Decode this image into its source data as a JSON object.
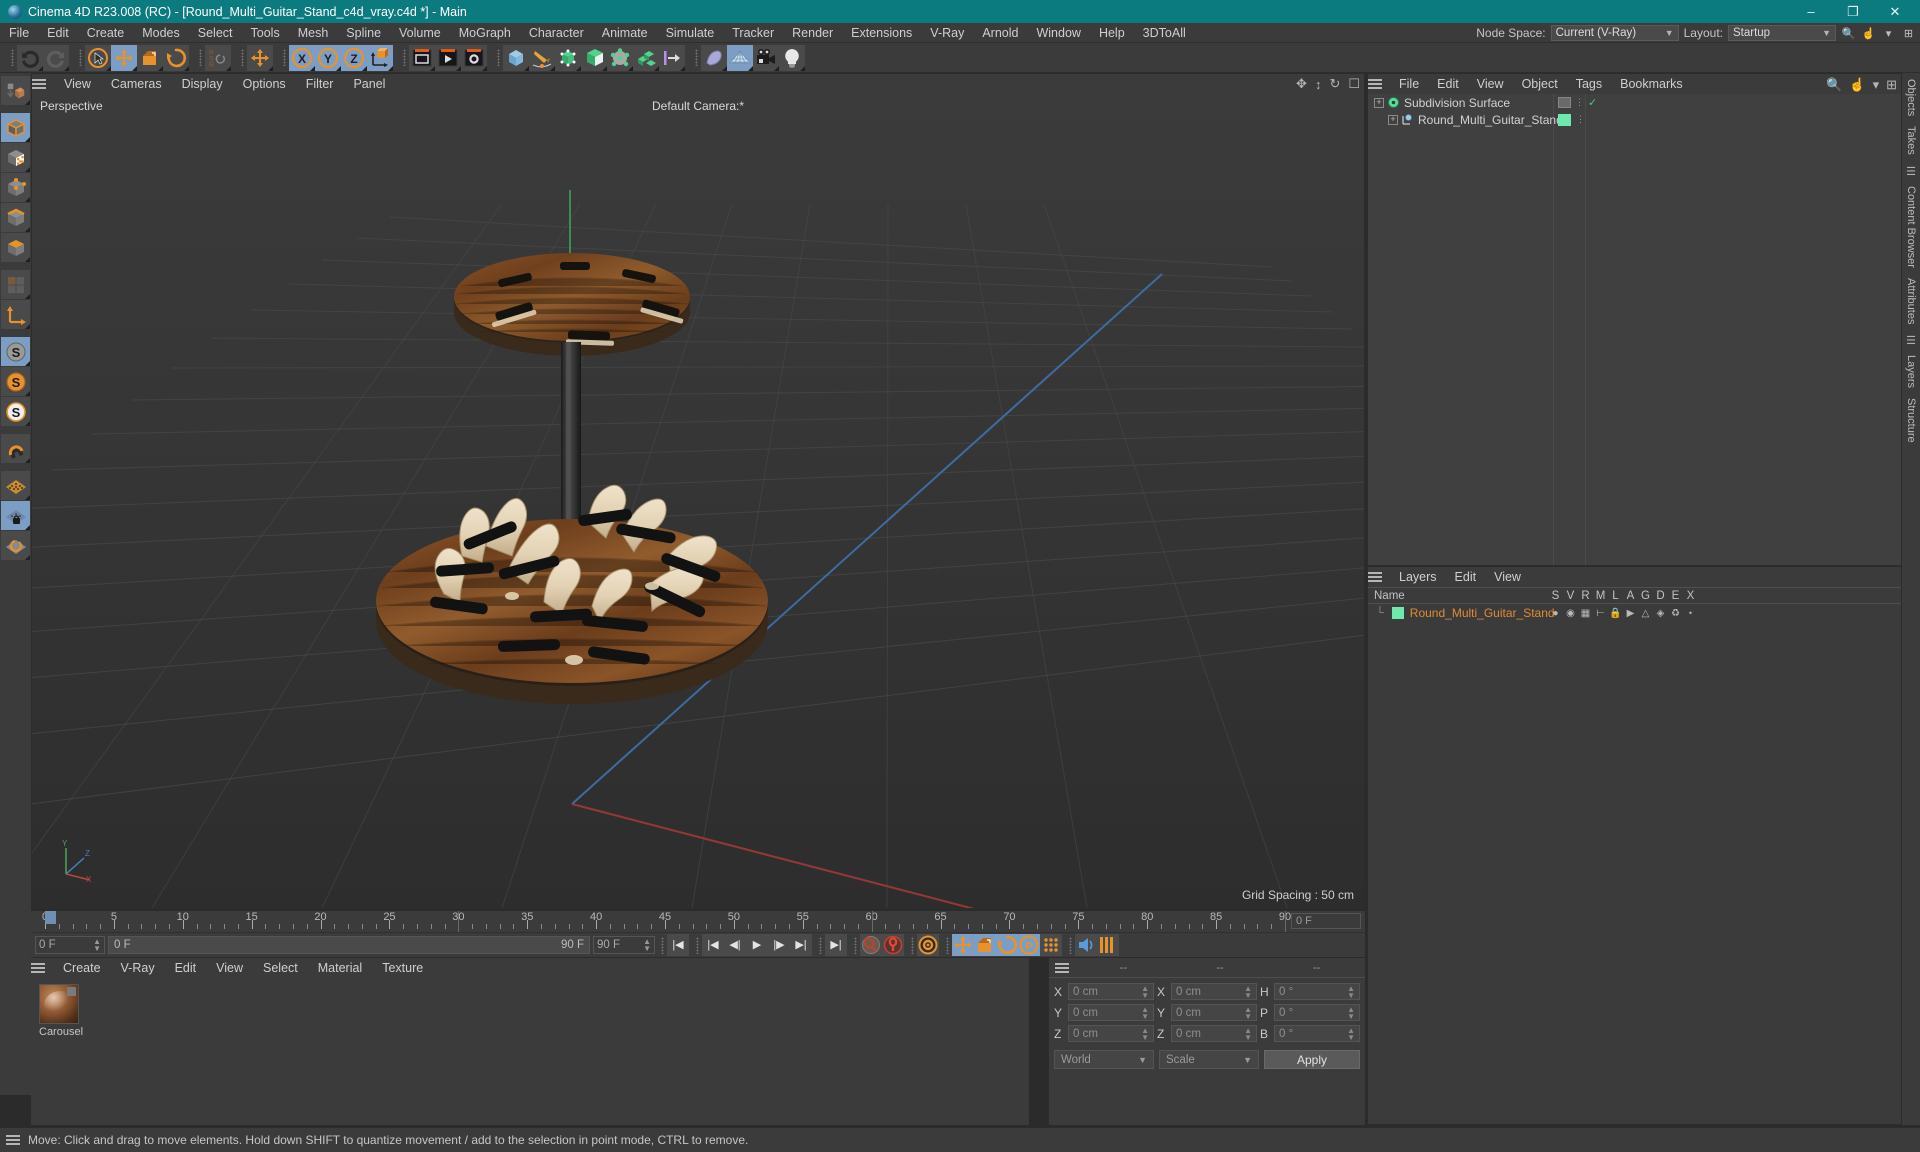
{
  "window": {
    "title": "Cinema 4D R23.008 (RC) - [Round_Multi_Guitar_Stand_c4d_vray.c4d *] - Main",
    "minimize": "–",
    "maximize": "❐",
    "close": "✕"
  },
  "menubar": {
    "items": [
      "File",
      "Edit",
      "Create",
      "Modes",
      "Select",
      "Tools",
      "Mesh",
      "Spline",
      "Volume",
      "MoGraph",
      "Character",
      "Animate",
      "Simulate",
      "Tracker",
      "Render",
      "Extensions",
      "V-Ray",
      "Arnold",
      "Window",
      "Help",
      "3DToAll"
    ],
    "node_space_label": "Node Space:",
    "node_space_value": "Current (V-Ray)",
    "layout_label": "Layout:",
    "layout_value": "Startup"
  },
  "toolbar": {
    "groups": [
      {
        "name": "history",
        "buttons": [
          {
            "name": "undo-button",
            "glyph": "undo",
            "active": false
          },
          {
            "name": "redo-button",
            "glyph": "redo",
            "active": false
          }
        ]
      },
      {
        "name": "transform",
        "buttons": [
          {
            "name": "select-tool-button",
            "glyph": "cursor-circle",
            "active": false
          },
          {
            "name": "move-tool-button",
            "glyph": "move",
            "active": true
          },
          {
            "name": "scale-tool-button",
            "glyph": "scale",
            "active": false
          },
          {
            "name": "rotate-tool-button",
            "glyph": "rotate",
            "active": false
          }
        ]
      },
      {
        "name": "psr",
        "buttons": [
          {
            "name": "psr-button",
            "glyph": "psr",
            "active": false
          }
        ]
      },
      {
        "name": "move-dup",
        "buttons": [
          {
            "name": "move-duplicate-button",
            "glyph": "move",
            "active": false
          }
        ]
      },
      {
        "name": "axes",
        "buttons": [
          {
            "name": "x-axis-lock-button",
            "glyph": "X",
            "active": true
          },
          {
            "name": "y-axis-lock-button",
            "glyph": "Y",
            "active": true
          },
          {
            "name": "z-axis-lock-button",
            "glyph": "Z",
            "active": true
          },
          {
            "name": "world-object-coord-button",
            "glyph": "axis-cube",
            "active": true
          }
        ]
      },
      {
        "name": "render",
        "buttons": [
          {
            "name": "render-view-button",
            "glyph": "render-view",
            "active": false
          },
          {
            "name": "render-queue-button",
            "glyph": "render-play",
            "active": false
          },
          {
            "name": "render-settings-button",
            "glyph": "render-gear",
            "active": false
          }
        ]
      },
      {
        "name": "primitives",
        "buttons": [
          {
            "name": "add-cube-button",
            "glyph": "cube-blue",
            "active": false
          },
          {
            "name": "add-spline-button",
            "glyph": "pen",
            "active": false
          },
          {
            "name": "add-nurbs-button",
            "glyph": "nurbs",
            "active": false
          },
          {
            "name": "add-array-button",
            "glyph": "array",
            "active": false
          },
          {
            "name": "add-deformer-button",
            "glyph": "deformer",
            "active": false
          },
          {
            "name": "add-mograph-button",
            "glyph": "mograph",
            "active": false
          },
          {
            "name": "add-field-button",
            "glyph": "field",
            "active": false
          }
        ]
      },
      {
        "name": "scene",
        "buttons": [
          {
            "name": "add-deformer2-button",
            "glyph": "bend",
            "active": false
          },
          {
            "name": "add-environment-button",
            "glyph": "floor",
            "active": true
          },
          {
            "name": "add-camera-button",
            "glyph": "camera",
            "active": false
          },
          {
            "name": "add-light-button",
            "glyph": "bulb",
            "active": false
          }
        ]
      }
    ]
  },
  "left_tools": [
    {
      "name": "move-down-tool",
      "glyph": "stack-down",
      "active": false
    },
    {
      "name": "model-mode-tool",
      "glyph": "cube-orange",
      "active": true
    },
    {
      "name": "texture-mode-tool",
      "glyph": "cube-checker",
      "active": false
    },
    {
      "name": "points-mode-tool",
      "glyph": "cube-points",
      "active": false
    },
    {
      "name": "edges-mode-tool",
      "glyph": "cube-edges",
      "active": false
    },
    {
      "name": "polygons-mode-tool",
      "glyph": "cube-polys",
      "active": false
    },
    {
      "name": "uv-mode-tool",
      "glyph": "uv-grid",
      "active": false
    },
    {
      "name": "axis-mode-tool",
      "glyph": "axis",
      "active": false
    },
    {
      "name": "snap-enable-tool",
      "glyph": "S-gray",
      "active": true
    },
    {
      "name": "snap-settings-tool",
      "glyph": "S-orange",
      "active": false
    },
    {
      "name": "snap-quantize-tool",
      "glyph": "S-white",
      "active": false
    },
    {
      "name": "magnet-tool",
      "glyph": "magnet",
      "active": false
    },
    {
      "name": "workplane-tool",
      "glyph": "plane-orange",
      "active": false
    },
    {
      "name": "workplane-lock-tool",
      "glyph": "plane-lock",
      "active": true
    },
    {
      "name": "workplane-rotate-tool",
      "glyph": "plane-rotate",
      "active": false
    }
  ],
  "viewport": {
    "menu": [
      "View",
      "Cameras",
      "Display",
      "Options",
      "Filter",
      "Panel"
    ],
    "perspective_label": "Perspective",
    "camera_label": "Default Camera:*",
    "grid_spacing": "Grid Spacing : 50 cm",
    "axis_labels": {
      "x": "X",
      "y": "Y",
      "z": "Z"
    }
  },
  "timeline": {
    "ticks": [
      0,
      5,
      10,
      15,
      20,
      25,
      30,
      35,
      40,
      45,
      50,
      55,
      60,
      65,
      70,
      75,
      80,
      85,
      90
    ],
    "min": 0,
    "max": 90,
    "current_frame": "0 F",
    "end_frame": "90 F",
    "start_field": "0 F",
    "preview_start": "0 F",
    "preview_end": "90 F",
    "right_field": "0 F"
  },
  "anim_toolbar": {
    "buttons": [
      {
        "name": "go-to-start-button",
        "glyph": "|◀",
        "active": false
      },
      {
        "name": "go-to-previous-key-button",
        "glyph": "|◀",
        "active": false
      },
      {
        "name": "step-back-button",
        "glyph": "◀|",
        "active": false
      },
      {
        "name": "play-button",
        "glyph": "▶",
        "active": false
      },
      {
        "name": "step-forward-button",
        "glyph": "|▶",
        "active": false
      },
      {
        "name": "go-to-next-key-button",
        "glyph": "▶|",
        "active": false
      },
      {
        "name": "go-to-end-button",
        "glyph": "▶|",
        "active": false
      },
      {
        "name": "record-key-button",
        "glyph": "key",
        "active": false
      },
      {
        "name": "autokey-button",
        "glyph": "autokey",
        "active": false
      },
      {
        "name": "keyframe-settings-button",
        "glyph": "gear-key",
        "active": false
      },
      {
        "name": "key-position-button",
        "glyph": "move",
        "active": true
      },
      {
        "name": "key-scale-button",
        "glyph": "scale",
        "active": true
      },
      {
        "name": "key-rotation-button",
        "glyph": "rotate",
        "active": true
      },
      {
        "name": "key-param-button",
        "glyph": "P",
        "active": true
      },
      {
        "name": "key-pla-button",
        "glyph": "dots",
        "active": false
      },
      {
        "name": "sound-button",
        "glyph": "sound",
        "active": false
      },
      {
        "name": "keyframe-mode-button",
        "glyph": "stripes",
        "active": false
      }
    ]
  },
  "material_manager": {
    "menu": [
      "Create",
      "V-Ray",
      "Edit",
      "View",
      "Select",
      "Material",
      "Texture"
    ],
    "materials": [
      {
        "name": "Carousel"
      }
    ]
  },
  "coordinates": {
    "header": [
      "--",
      "--",
      "--"
    ],
    "rows": [
      {
        "label1": "X",
        "value1": "0 cm",
        "label2": "X",
        "value2": "0 cm",
        "label3": "H",
        "value3": "0 °"
      },
      {
        "label1": "Y",
        "value1": "0 cm",
        "label2": "Y",
        "value2": "0 cm",
        "label3": "P",
        "value3": "0 °"
      },
      {
        "label1": "Z",
        "value1": "0 cm",
        "label2": "Z",
        "value2": "0 cm",
        "label3": "B",
        "value3": "0 °"
      }
    ],
    "system": "World",
    "mode": "Scale",
    "apply": "Apply"
  },
  "object_manager": {
    "menu": [
      "File",
      "Edit",
      "View",
      "Object",
      "Tags",
      "Bookmarks"
    ],
    "rows": [
      {
        "name": "Subdivision Surface",
        "indent": 0,
        "dot_color": "#55e08a",
        "has_tag": true,
        "tag_check": true
      },
      {
        "name": "Round_Multi_Guitar_Stand",
        "indent": 1,
        "dot_color": "#9ecbe8",
        "has_tag": true,
        "swatch": "#6fe8ae"
      }
    ]
  },
  "layer_manager": {
    "menu": [
      "Layers",
      "Edit",
      "View"
    ],
    "columns": [
      "Name",
      "S",
      "V",
      "R",
      "M",
      "L",
      "A",
      "G",
      "D",
      "E",
      "X"
    ],
    "rows": [
      {
        "name": "Round_Multi_Guitar_Stand",
        "color": "#6fe8ae"
      }
    ]
  },
  "right_rail": {
    "labels": [
      "Objects",
      "Takes",
      "Content Browser",
      "Attributes",
      "Layers",
      "Structure"
    ]
  },
  "statusbar": {
    "message": "Move: Click and drag to move elements. Hold down SHIFT to quantize movement / add to the selection in point mode, CTRL to remove."
  },
  "colors": {
    "title_bar": "#0c7b7f",
    "panel_bg": "#3b3b3b",
    "accent_blue": "#7d9ec4",
    "orange": "#e8922b",
    "layer_green": "#6fe8ae",
    "layer_name": "#e08a33"
  }
}
